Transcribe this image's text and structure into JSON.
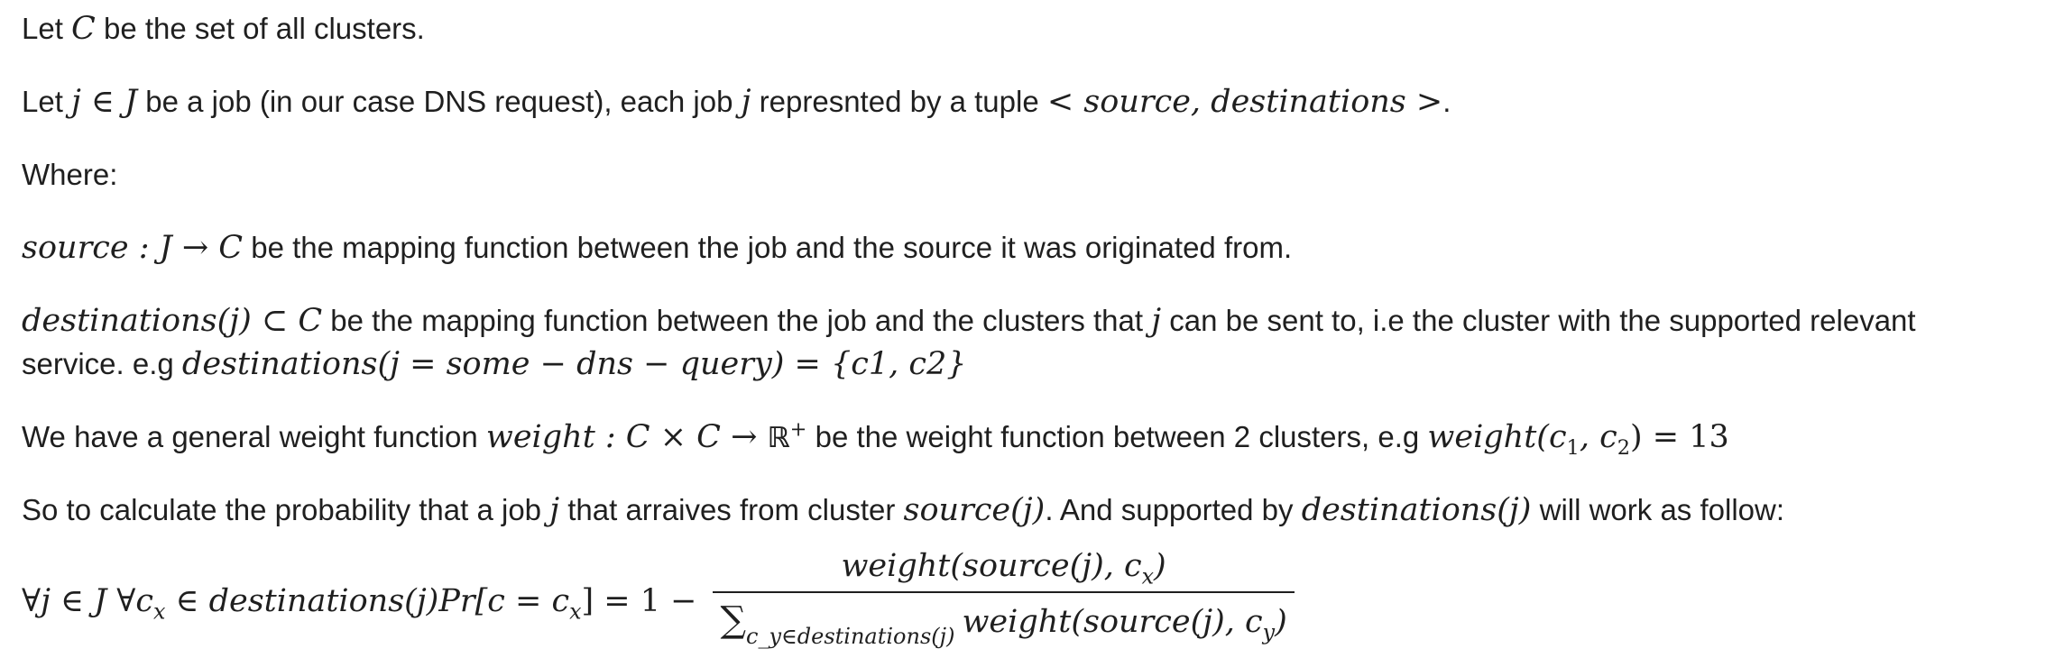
{
  "paragraphs": {
    "p1": {
      "t1": "Let ",
      "m1": "C",
      "t2": " be the set of all clusters."
    },
    "p2": {
      "t1": "Let ",
      "m1": "j ∈ J",
      "t2": " be a job (in our case DNS request), each job ",
      "m2": "j",
      "t3": " represnted by a tuple ",
      "m3": "< source, destinations >",
      "t4": "."
    },
    "p3": {
      "t1": "Where:"
    },
    "p4": {
      "m1": "source : J → C",
      "t1": " be the mapping function between the job and the source it was originated from."
    },
    "p5": {
      "m1": "destinations(j) ⊂ C",
      "t1": " be the mapping function between the job and the clusters that ",
      "m2": "j",
      "t2": " can be sent to, i.e the cluster with the supported relevant",
      "t3": "service. e.g ",
      "m3": "destinations(j = some − dns − query) = {c1, c2}"
    },
    "p6": {
      "t1": "We have a general weight function ",
      "m1": "weight : C × C → ",
      "m1_reals": "ℝ",
      "m1_sup": "+",
      "t2": " be the weight function between 2 clusters, e.g ",
      "m2a": "weight(c",
      "m2_sub1": "1",
      "m2b": ", c",
      "m2_sub2": "2",
      "m2c": ") = 13"
    },
    "p7": {
      "t1": "So to calculate the probability that a job ",
      "m1": "j",
      "t2": " that arraives from cluster ",
      "m2": "source(j)",
      "t3": ". And supported by ",
      "m3": "destinations(j)",
      "t4": " will work as follow:"
    },
    "formula": {
      "lhs_a": "∀j ∈ J ∀c",
      "lhs_sub1": "x",
      "lhs_b": " ∈ destinations(j)Pr[c = c",
      "lhs_sub2": "x",
      "lhs_c": "] = 1 −",
      "num_a": "weight(source(j), c",
      "num_sub": "x",
      "num_b": ")",
      "den_sigma": "∑",
      "den_sumsub": "c_y∈destinations(j)",
      "den_a": "weight(source(j), c",
      "den_sub": "y",
      "den_b": ")"
    }
  }
}
